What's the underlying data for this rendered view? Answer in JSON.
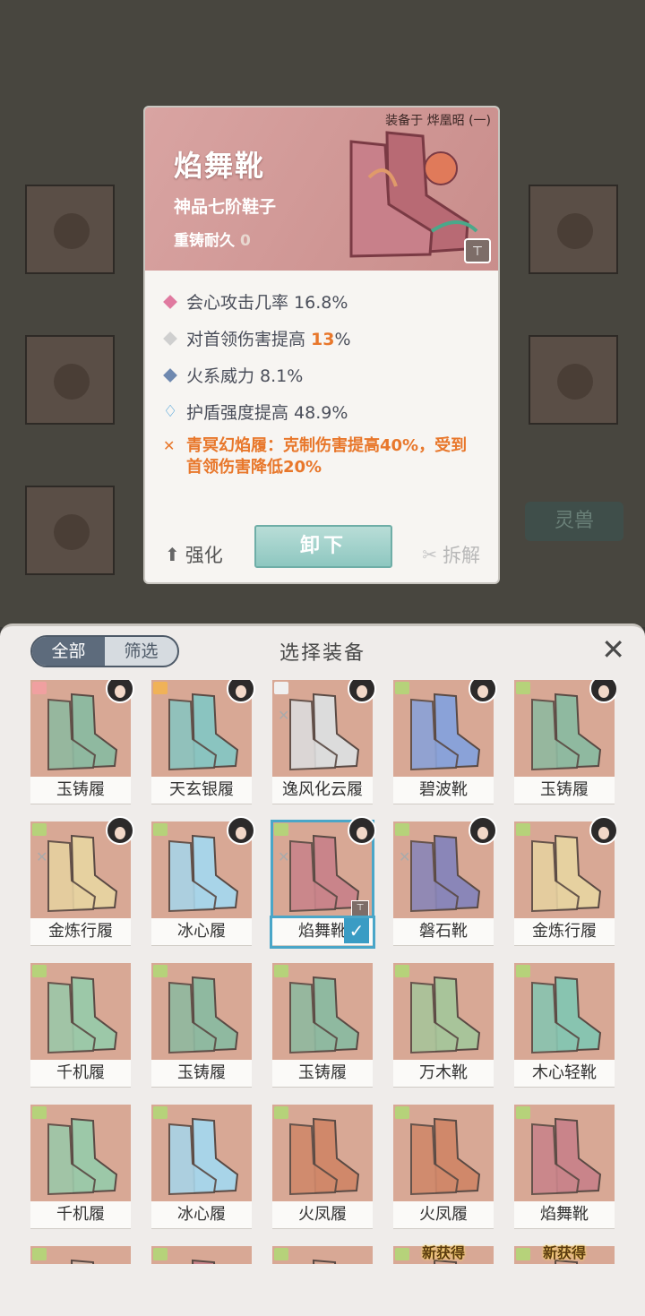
{
  "background": {
    "side_tab_label": "灵兽"
  },
  "detail": {
    "equipped_on": "装备于 烨凰昭 (一)",
    "name": "焰舞靴",
    "grade": "神品七阶鞋子",
    "recast_label": "重铸耐久",
    "recast_value": "0",
    "attributes": [
      {
        "marker": "pink-diamond",
        "text": "会心攻击几率 16.8%"
      },
      {
        "marker": "grey-diamond",
        "text_prefix": "对首领伤害提高 ",
        "highlight": "13",
        "text_suffix": "%"
      },
      {
        "marker": "blue-diamond",
        "text": "火系威力 8.1%"
      },
      {
        "marker": "water-drop-icon",
        "text": "护盾强度提高 48.9%"
      }
    ],
    "set_effect": "青冥幻焰履：克制伤害提高40%，受到首领伤害降低20%",
    "buttons": {
      "upgrade": "强化",
      "unequip": "卸下",
      "dismantle": "拆解"
    }
  },
  "panel": {
    "title": "选择装备",
    "tabs": [
      "全部",
      "筛选"
    ],
    "items": [
      {
        "name": "玉铸履",
        "color": "#8fb9a0",
        "tag": "pink",
        "face": true
      },
      {
        "name": "天玄银履",
        "color": "#8ac4c0",
        "tag": "orange",
        "face": true
      },
      {
        "name": "逸风化云履",
        "color": "#dcdcdc",
        "tag": "white",
        "face": true,
        "crossed": true
      },
      {
        "name": "碧波靴",
        "color": "#8aa2d8",
        "tag": "green",
        "face": true
      },
      {
        "name": "玉铸履",
        "color": "#8fb9a0",
        "tag": "green",
        "face": true
      },
      {
        "name": "金炼行履",
        "color": "#e6d1a0",
        "tag": "green",
        "face": true,
        "crossed": true
      },
      {
        "name": "冰心履",
        "color": "#a8d4e8",
        "tag": "green",
        "face": true
      },
      {
        "name": "焰舞靴",
        "color": "#c9848a",
        "tag": "green",
        "face": true,
        "crossed": true,
        "selected": true,
        "locked": true
      },
      {
        "name": "磐石靴",
        "color": "#8a86b8",
        "tag": "green",
        "face": true,
        "crossed": true
      },
      {
        "name": "金炼行履",
        "color": "#e6d1a0",
        "tag": "green",
        "face": true
      },
      {
        "name": "千机履",
        "color": "#9cc8a8",
        "tag": "green"
      },
      {
        "name": "玉铸履",
        "color": "#8fb9a0",
        "tag": "green"
      },
      {
        "name": "玉铸履",
        "color": "#8fb9a0",
        "tag": "green"
      },
      {
        "name": "万木靴",
        "color": "#a8c49a",
        "tag": "green"
      },
      {
        "name": "木心轻靴",
        "color": "#88c4b0",
        "tag": "green"
      },
      {
        "name": "千机履",
        "color": "#9cc8a8",
        "tag": "green"
      },
      {
        "name": "冰心履",
        "color": "#a8d4e8",
        "tag": "green"
      },
      {
        "name": "火凤履",
        "color": "#d0886a",
        "tag": "green"
      },
      {
        "name": "火凤履",
        "color": "#d0886a",
        "tag": "green"
      },
      {
        "name": "焰舞靴",
        "color": "#c9848a",
        "tag": "green"
      },
      {
        "name": "",
        "color": "#d8b8a8",
        "tag": "green"
      },
      {
        "name": "",
        "color": "#c9848a",
        "tag": "green"
      },
      {
        "name": "",
        "color": "#d8a895",
        "tag": "green"
      },
      {
        "name": "",
        "color": "#d8a895",
        "tag": "green",
        "new_label": "新获得"
      },
      {
        "name": "",
        "color": "#d8a895",
        "tag": "green",
        "new_label": "新获得"
      }
    ]
  }
}
